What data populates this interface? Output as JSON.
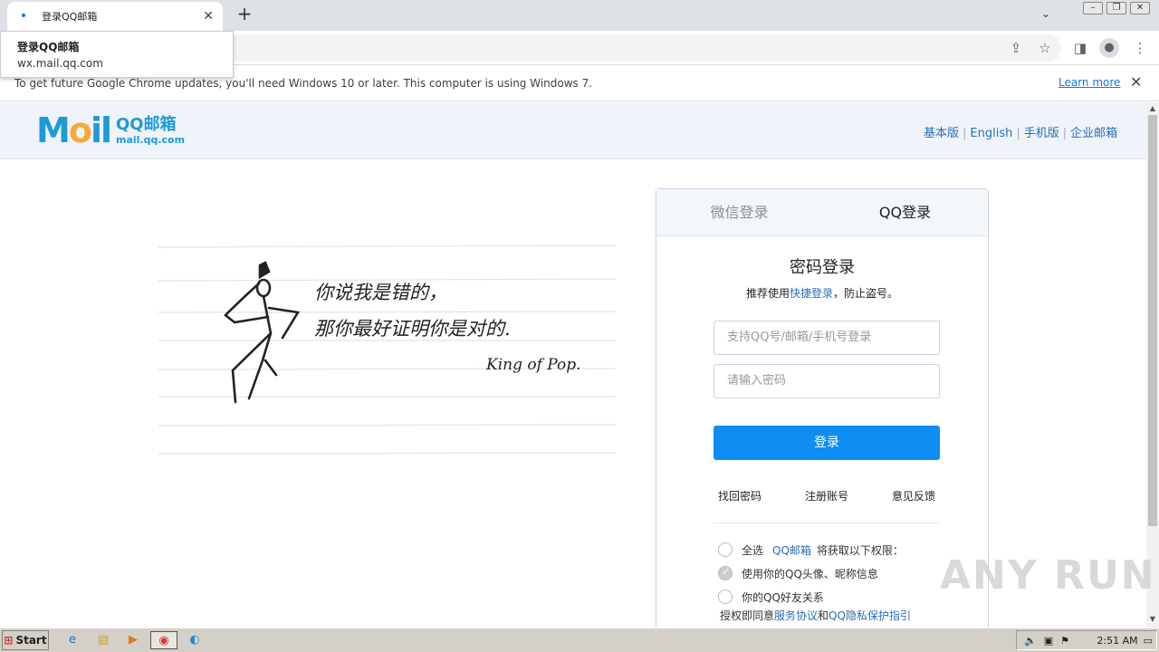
{
  "browser": {
    "tab_title": "登录QQ邮箱",
    "tooltip_title": "登录QQ邮箱",
    "tooltip_url": "wx.mail.qq.com",
    "new_tab": "+",
    "infobar_message": "To get future Google Chrome updates, you'll need Windows 10 or later. This computer is using Windows 7.",
    "infobar_link": "Learn more"
  },
  "header": {
    "logo_text": "QQ邮箱",
    "logo_url": "mail.qq.com",
    "links": [
      "基本版",
      "English",
      "手机版",
      "企业邮箱"
    ]
  },
  "art": {
    "line1": "你说我是错的，",
    "line2": "那你最好证明你是对的.",
    "signature": "King of Pop."
  },
  "login": {
    "tab_wechat": "微信登录",
    "tab_qq": "QQ登录",
    "title": "密码登录",
    "sub_prefix": "推荐使用",
    "sub_link": "快捷登录",
    "sub_suffix": "，防止盗号。",
    "account_placeholder": "支持QQ号/邮箱/手机号登录",
    "password_placeholder": "请输入密码",
    "login_button": "登录",
    "forgot": "找回密码",
    "register": "注册账号",
    "feedback": "意见反馈",
    "perm_all": "全选",
    "perm_app": "QQ邮箱",
    "perm_suffix": "将获取以下权限：",
    "perm_avatar": "使用你的QQ头像、昵称信息",
    "perm_friends": "你的QQ好友关系",
    "agree_prefix": "授权即同意",
    "agree_terms": "服务协议",
    "agree_and": "和",
    "agree_privacy": "QQ隐私保护指引"
  },
  "watermark": "ANY RUN",
  "taskbar": {
    "start": "Start",
    "clock": "2:51 AM"
  },
  "colors": {
    "accent": "#0e8df2",
    "link": "#2a6db5",
    "header_bg": "#eff4fa"
  }
}
